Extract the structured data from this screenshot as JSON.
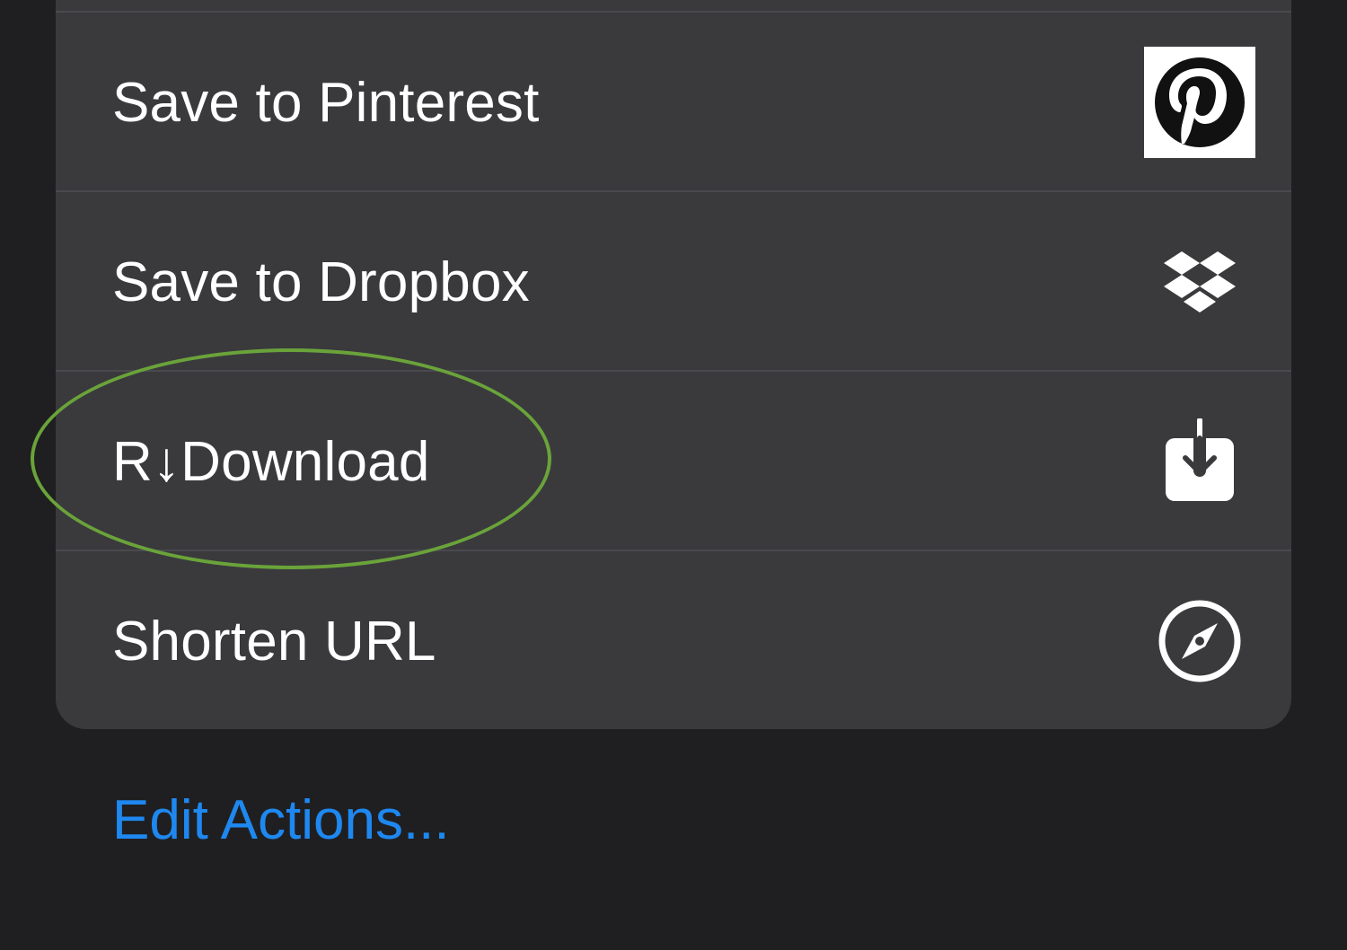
{
  "actions": [
    {
      "label": "Save to Pinterest",
      "icon": "pinterest-icon"
    },
    {
      "label": "Save to Dropbox",
      "icon": "dropbox-icon"
    },
    {
      "label": "R↓Download",
      "icon": "download-icon"
    },
    {
      "label": "Shorten URL",
      "icon": "compass-icon"
    }
  ],
  "footer": {
    "edit_label": "Edit Actions..."
  },
  "colors": {
    "sheet_background": "#3a3a3d",
    "page_background": "#1f1f21",
    "link_blue": "#1e88f0",
    "highlight_green": "#6aa33a"
  }
}
